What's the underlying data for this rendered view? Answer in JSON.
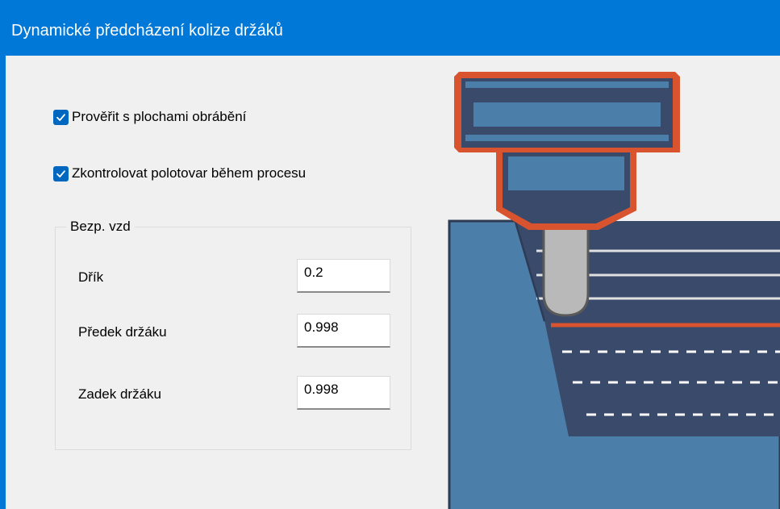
{
  "window": {
    "title": "Dynamické předcházení kolize držáků"
  },
  "options": {
    "check_surfaces": {
      "label": "Prověřit s plochami obrábění",
      "checked": true
    },
    "check_stock": {
      "label": "Zkontrolovat polotovar během procesu",
      "checked": true
    }
  },
  "clearance": {
    "group_label": "Bezp. vzd",
    "shank": {
      "label": "Dřík",
      "value": "0.2"
    },
    "holder_front": {
      "label": "Předek držáku",
      "value": "0.998"
    },
    "holder_back": {
      "label": "Zadek držáku",
      "value": "0.998"
    }
  },
  "colors": {
    "titlebar": "#0078d7",
    "accent": "#0067c0",
    "holder_outline": "#d9532f",
    "holder_dark": "#3a4a6b",
    "holder_light": "#4b7ea8",
    "stock": "#4b7ea8",
    "tool": "#b9b9b9"
  }
}
